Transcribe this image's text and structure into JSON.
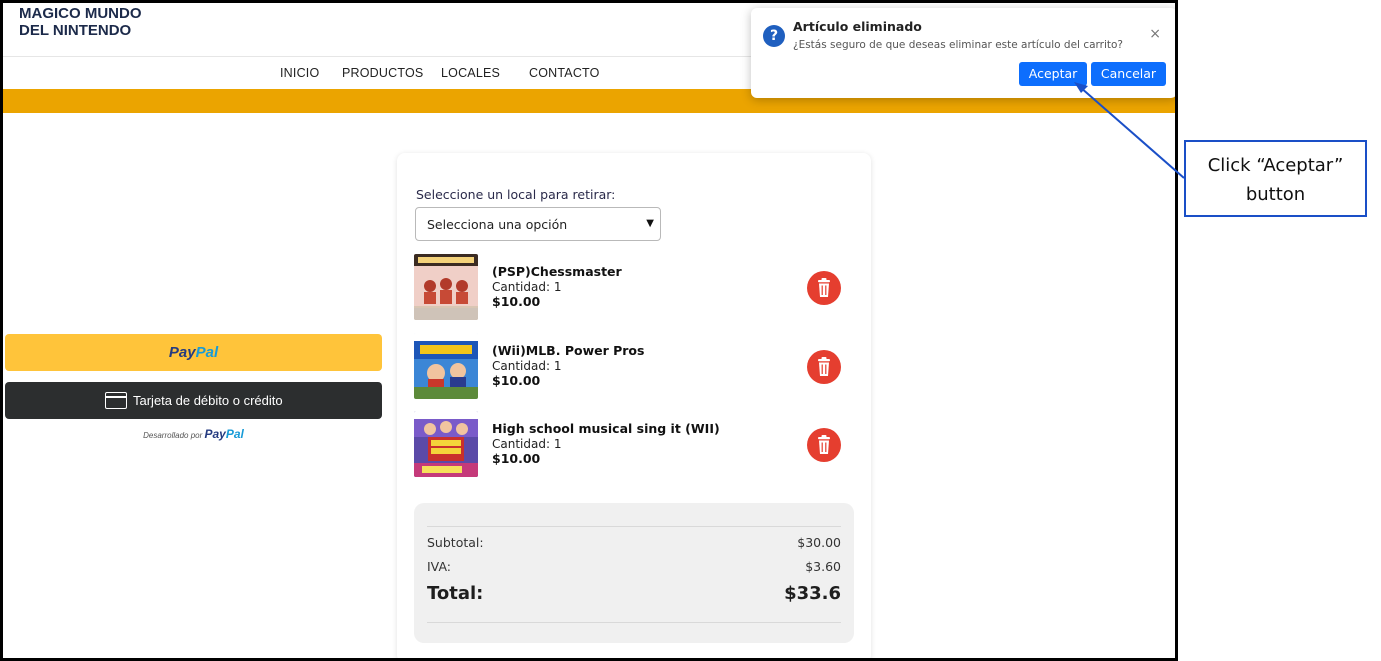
{
  "header": {
    "brand_line1": "MAGICO MUNDO",
    "brand_line2": "DEL NINTENDO"
  },
  "nav": {
    "items": [
      "INICIO",
      "PRODUCTOS",
      "LOCALES",
      "CONTACTO"
    ]
  },
  "colors": {
    "accent_bar": "#eba400",
    "paypal_yellow": "#ffc43a",
    "card_button": "#2c2e2f",
    "delete_red": "#e53e2f",
    "dialog_button_blue": "#0d6efd",
    "callout_border": "#1a4fc7"
  },
  "payment": {
    "paypal_pay": "Pay",
    "paypal_pal": "Pal",
    "card_label": "Tarjeta de débito o crédito",
    "powered_prefix": "Desarrollado por",
    "powered_pay": "Pay",
    "powered_pal": "Pal"
  },
  "cart": {
    "pickup_label": "Seleccione un local para retirar:",
    "pickup_select_value": "Selecciona una opción",
    "items": [
      {
        "name": "(PSP)Chessmaster",
        "quantity": "Cantidad: 1",
        "price": "$10.00",
        "icon": "trash-icon"
      },
      {
        "name": "(Wii)MLB. Power Pros",
        "quantity": "Cantidad: 1",
        "price": "$10.00",
        "icon": "trash-icon"
      },
      {
        "name": "High school musical sing it (WII)",
        "quantity": "Cantidad: 1",
        "price": "$10.00",
        "icon": "trash-icon"
      }
    ],
    "summary": {
      "subtotal_label": "Subtotal:",
      "subtotal_value": "$30.00",
      "iva_label": "IVA:",
      "iva_value": "$3.60",
      "total_label": "Total:",
      "total_value": "$33.6"
    }
  },
  "dialog": {
    "icon": "question-icon",
    "title": "Artículo eliminado",
    "message": "¿Estás seguro de que deseas eliminar este artículo del carrito?",
    "close": "×",
    "accept_label": "Aceptar",
    "cancel_label": "Cancelar"
  },
  "callout": {
    "line1": "Click “Aceptar”",
    "line2": "button"
  }
}
